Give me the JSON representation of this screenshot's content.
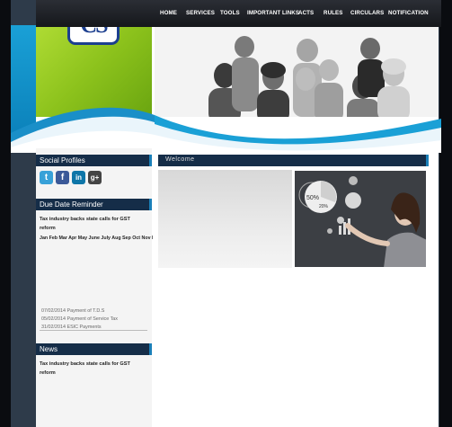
{
  "logo": {
    "text": "CS"
  },
  "nav": {
    "items": [
      "HOME",
      "SERVICES",
      "TOOLS",
      "IMPORTANT LINKS",
      "ACTS",
      "RULES",
      "CIRCULARS",
      "NOTIFICATION"
    ]
  },
  "sidebar": {
    "social_title": "Social Profiles",
    "social_icons": [
      {
        "icon": "twitter-icon",
        "glyph": "t",
        "color": "#38a1d8"
      },
      {
        "icon": "facebook-icon",
        "glyph": "f",
        "color": "#3b5998"
      },
      {
        "icon": "linkedin-icon",
        "glyph": "in",
        "color": "#0e76a8"
      },
      {
        "icon": "googleplus-icon",
        "glyph": "g+",
        "color": "#444"
      }
    ],
    "due_title": "Due Date Reminder",
    "due_news_1": "Tax industry backs state calls for GST",
    "due_news_2": "reform",
    "months": "Jan Feb Mar Apr May June July Aug Sep Oct Nov Dec",
    "payments": [
      "07/02/2014 Payment of T.D.S",
      "05/02/2014 Payment of Service Tax",
      "31/02/2014 ESIC Payments"
    ],
    "news_title": "News",
    "news_1": "Tax industry backs state calls for GST",
    "news_2": "reform"
  },
  "content": {
    "title": "Welcome"
  },
  "chart_labels": {
    "pct50": "50%",
    "pct20": "20%"
  },
  "colors": {
    "nav_bg": "#1c1f24",
    "header_bar": "#152d48",
    "green": "#8cc21c",
    "blue": "#1aa0d6"
  }
}
